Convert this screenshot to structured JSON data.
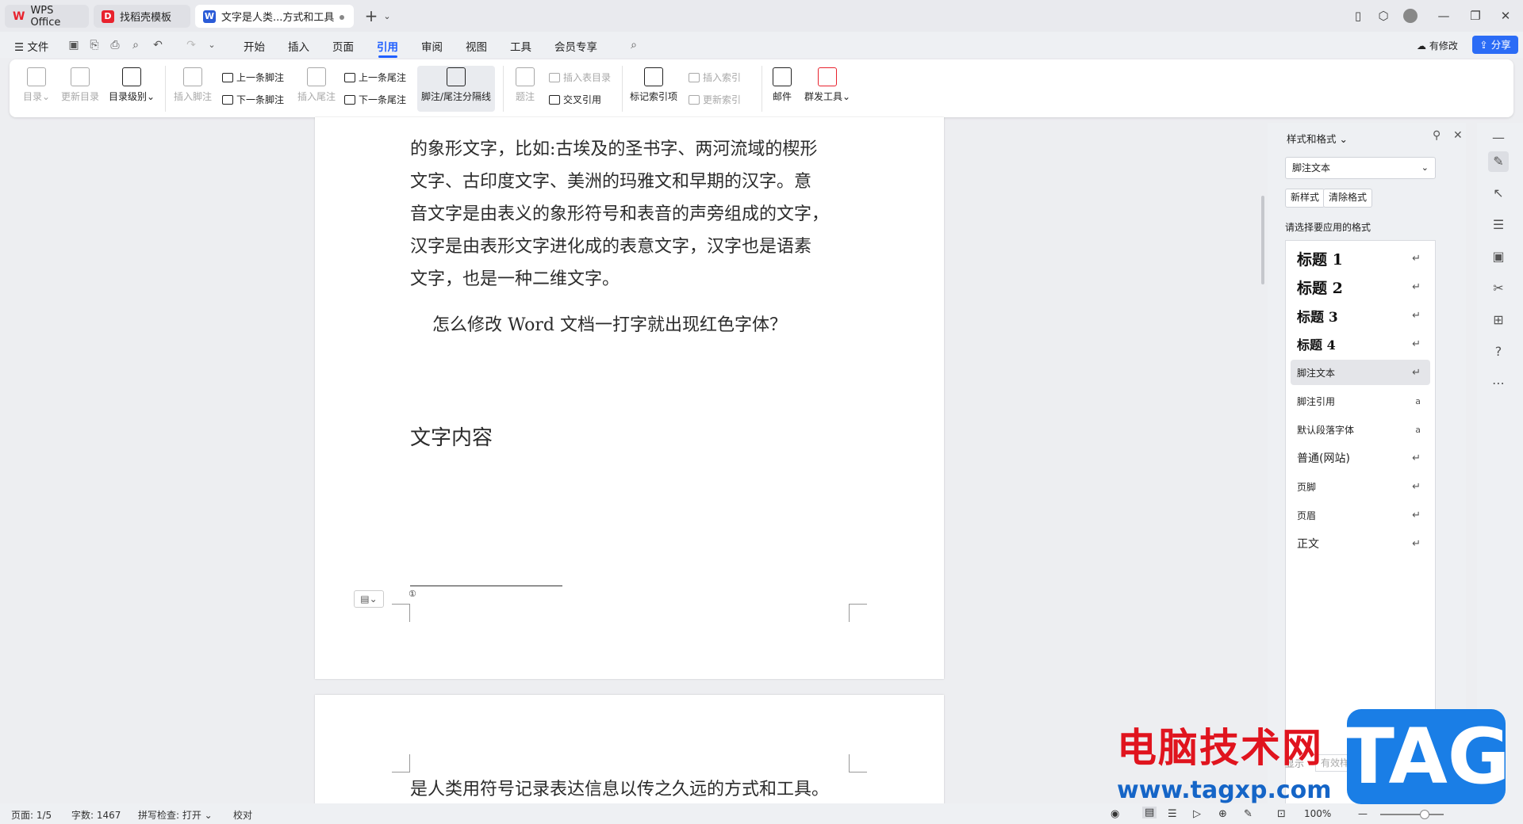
{
  "tabs": [
    {
      "label": "WPS Office",
      "icon": "wps-logo-icon",
      "color": "#e8222d"
    },
    {
      "label": "找稻壳模板",
      "icon": "docer-icon",
      "color": "#e8222d"
    },
    {
      "label": "文字是人类...方式和工具",
      "icon": "writer-doc-icon",
      "color": "#2a5bd7"
    }
  ],
  "menubar": {
    "file": "文件",
    "items": [
      "开始",
      "插入",
      "页面",
      "引用",
      "审阅",
      "视图",
      "工具",
      "会员专享"
    ],
    "active": "引用",
    "has_changes": "有修改",
    "share": "分享"
  },
  "ribbon": {
    "toc": "目录",
    "update_toc": "更新目录",
    "toc_level": "目录级别",
    "insert_footnote": "插入脚注",
    "prev_footnote": "上一条脚注",
    "next_footnote": "下一条脚注",
    "insert_endnote": "插入尾注",
    "prev_endnote": "上一条尾注",
    "next_endnote": "下一条尾注",
    "separator_line": "脚注/尾注分隔线",
    "caption": "题注",
    "insert_table_of_figures": "插入表目录",
    "cross_reference": "交叉引用",
    "mark_index_entry": "标记索引项",
    "insert_index": "插入索引",
    "update_index": "更新索引",
    "mail": "邮件",
    "mail_merge": "群发工具"
  },
  "document": {
    "lines": [
      "的象形文字，比如:古埃及的圣书字、两河流域的楔形",
      "文字、古印度文字、美洲的玛雅文和早期的汉字。意",
      "音文字是由表义的象形符号和表音的声旁组成的文字，",
      "汉字是由表形文字进化成的表意文字，汉字也是语素",
      "文字，也是一种二维文字。"
    ],
    "question": "怎么修改 Word 文档一打字就出现红色字体？",
    "heading": "文字内容",
    "footnote_mark": "①",
    "page2_line": "是人类用符号记录表达信息以传之久远的方式和工具。"
  },
  "style_panel": {
    "title": "样式和格式",
    "current_style": "脚注文本",
    "new_style": "新样式",
    "clear_format": "清除格式",
    "prompt": "请选择要应用的格式",
    "styles": [
      {
        "label": "标题  1",
        "kind": "heading",
        "mark": "↵"
      },
      {
        "label": "标题  2",
        "kind": "heading",
        "mark": "↵"
      },
      {
        "label": "标题  3",
        "kind": "heading",
        "mark": "↵"
      },
      {
        "label": "标题 4",
        "kind": "heading",
        "mark": "↵"
      },
      {
        "label": "脚注文本",
        "kind": "normal",
        "mark": "↵",
        "selected": true
      },
      {
        "label": "脚注引用",
        "kind": "normal",
        "mark": "a"
      },
      {
        "label": "默认段落字体",
        "kind": "normal",
        "mark": "a"
      },
      {
        "label": "普通(网站)",
        "kind": "normal",
        "mark": "↵"
      },
      {
        "label": "页脚",
        "kind": "normal",
        "mark": "↵"
      },
      {
        "label": "页眉",
        "kind": "normal",
        "mark": "↵"
      },
      {
        "label": "正文",
        "kind": "normal",
        "mark": "↵"
      }
    ],
    "show_label": "显示",
    "show_value": "有效样式"
  },
  "statusbar": {
    "page": "页面: 1/5",
    "words": "字数: 1467",
    "spell_check": "拼写检查: 打开",
    "proofread": "校对",
    "zoom": "100%"
  },
  "watermark": {
    "site_name": "电脑技术网",
    "url": "www.tagxp.com",
    "tag": "TAG"
  },
  "colors": {
    "accent": "#1f5fff",
    "share_bg": "#2b6cf6",
    "wps_red": "#e8222d"
  }
}
